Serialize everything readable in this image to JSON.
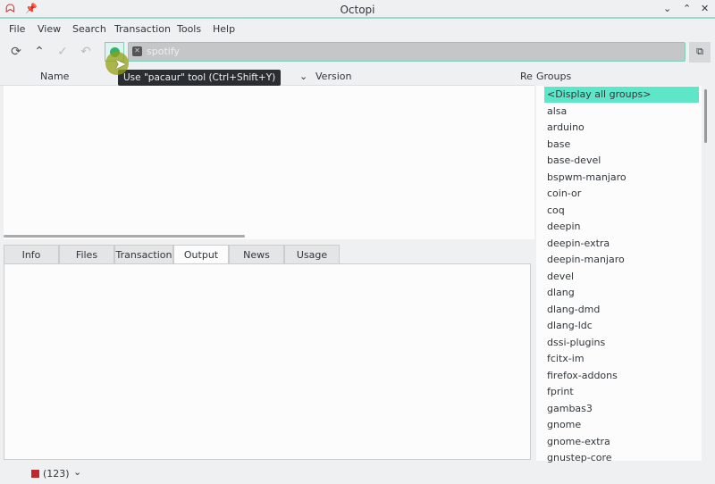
{
  "window": {
    "title": "Octopi"
  },
  "menu": [
    "File",
    "View",
    "Search",
    "Transaction",
    "Tools",
    "Help"
  ],
  "search": {
    "value": "spotify"
  },
  "tooltip": "Use \"pacaur\" tool  (Ctrl+Shift+Y)",
  "columns": [
    "Name",
    "Version",
    "Re",
    "Groups"
  ],
  "tabs": [
    "Info",
    "Files",
    "Transaction",
    "Output",
    "News",
    "Usage"
  ],
  "active_tab": "Output",
  "groups": [
    "<Display all groups>",
    "alsa",
    "arduino",
    "base",
    "base-devel",
    "bspwm-manjaro",
    "coin-or",
    "coq",
    "deepin",
    "deepin-extra",
    "deepin-manjaro",
    "devel",
    "dlang",
    "dlang-dmd",
    "dlang-ldc",
    "dssi-plugins",
    "fcitx-im",
    "firefox-addons",
    "fprint",
    "gambas3",
    "gnome",
    "gnome-extra",
    "gnustep-core"
  ],
  "status": {
    "count": "(123)",
    "color": "#c0282d"
  },
  "accent": "#5ee6c9"
}
